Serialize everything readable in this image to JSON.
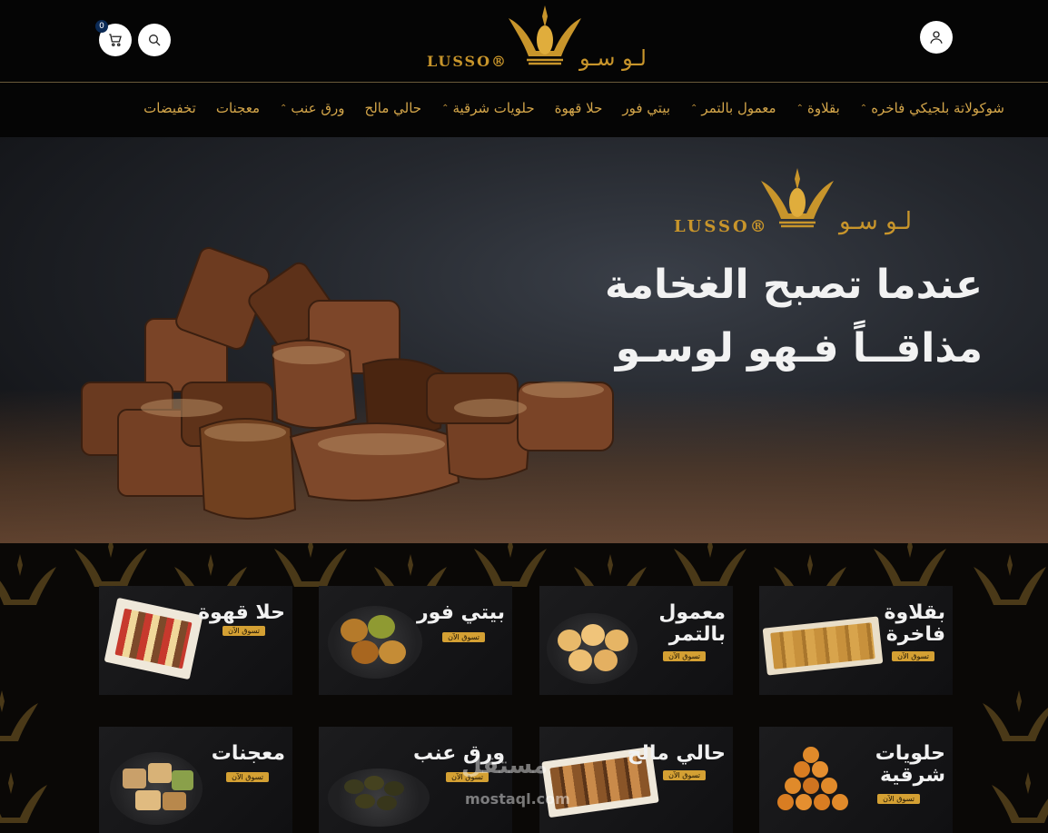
{
  "header": {
    "cart_count": "0",
    "logo_latin": "LUSSO®",
    "logo_arabic": "لـو سـو"
  },
  "nav": {
    "items": [
      {
        "label": "شوكولاتة بلجيكي فاخره",
        "has_caret": true
      },
      {
        "label": "بقلاوة",
        "has_caret": true
      },
      {
        "label": "معمول بالتمر",
        "has_caret": true
      },
      {
        "label": "بيتي فور",
        "has_caret": false
      },
      {
        "label": "حلا قهوة",
        "has_caret": false
      },
      {
        "label": "حلويات شرقية",
        "has_caret": true
      },
      {
        "label": "حالي مالح",
        "has_caret": false
      },
      {
        "label": "ورق عنب",
        "has_caret": true
      },
      {
        "label": "معجنات",
        "has_caret": false
      },
      {
        "label": "تخفيضات",
        "has_caret": false
      }
    ]
  },
  "hero": {
    "logo_latin": "LUSSO®",
    "logo_arabic": "لـو سـو",
    "line1": "عندما تصبح الغخامة",
    "line2": "مذاقــاً فـهو لوسـو"
  },
  "categories": [
    {
      "title": "حلا قهوة",
      "cta": "تسوق الآن"
    },
    {
      "title": "بيتي فور",
      "cta": "تسوق الآن"
    },
    {
      "title": "معمول بالتمر",
      "cta": "تسوق الآن"
    },
    {
      "title": "بقلاوة فاخرة",
      "cta": "تسوق الآن"
    },
    {
      "title": "معجنات",
      "cta": "تسوق الآن"
    },
    {
      "title": "ورق عنب",
      "cta": "تسوق الآن"
    },
    {
      "title": "حالي مالح",
      "cta": "تسوق الآن"
    },
    {
      "title": "حلويات شرقية",
      "cta": "تسوق الآن"
    }
  ],
  "watermark": {
    "arabic": "مستقل",
    "latin": "mostaql.com"
  },
  "colors": {
    "gold": "#d4a64a",
    "background": "#050505",
    "cta": "#d4a033"
  },
  "icons": {
    "cart": "cart-icon",
    "search": "search-icon",
    "user": "user-icon",
    "logo": "crown-logo-icon"
  }
}
